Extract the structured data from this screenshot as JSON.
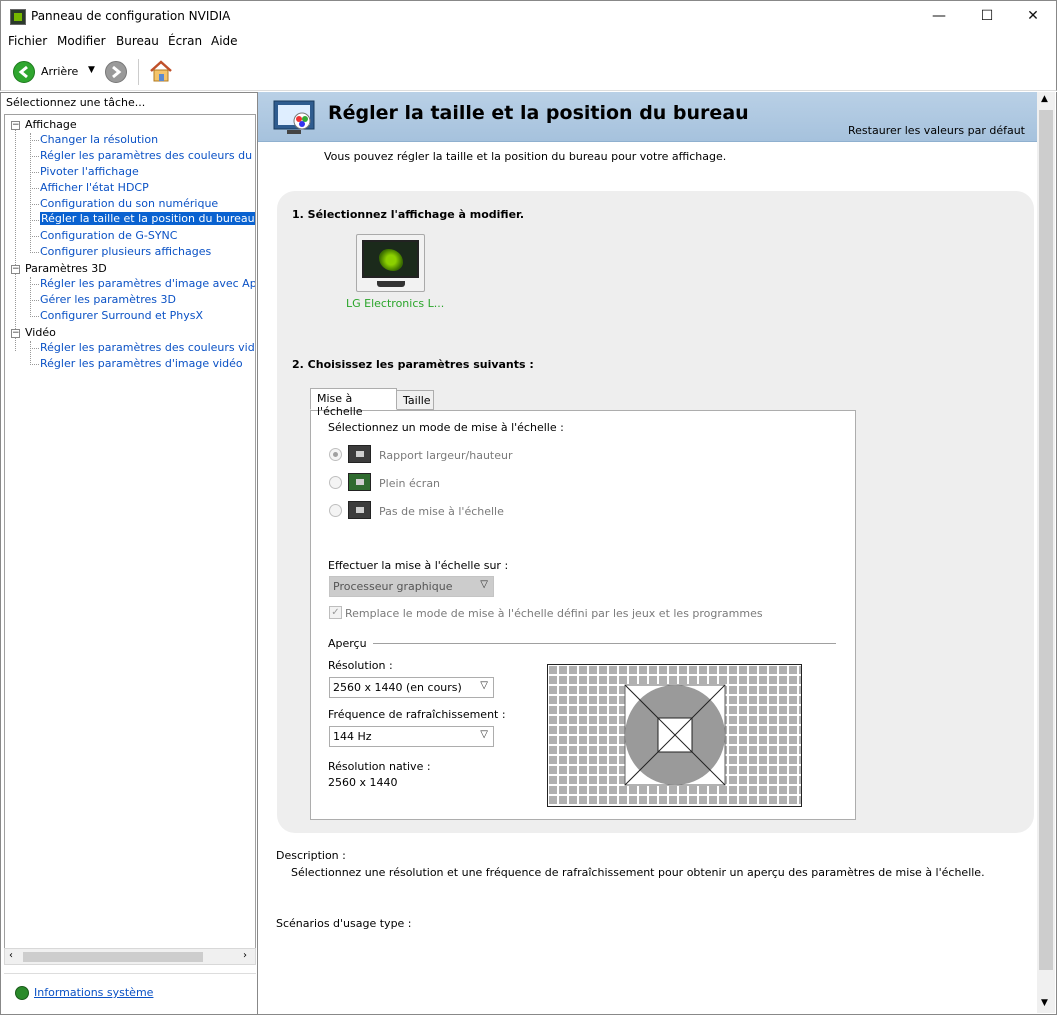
{
  "window": {
    "title": "Panneau de configuration NVIDIA",
    "minimize": "—",
    "maximize": "☐",
    "close": "✕"
  },
  "menu": {
    "items": [
      "Fichier",
      "Modifier",
      "Bureau",
      "Écran",
      "Aide"
    ]
  },
  "toolbar": {
    "back_label": "Arrière"
  },
  "sidebar": {
    "header": "Sélectionnez une tâche...",
    "categories": [
      {
        "label": "Affichage",
        "items": [
          "Changer la résolution",
          "Régler les paramètres des couleurs du bureau",
          "Pivoter l'affichage",
          "Afficher l'état HDCP",
          "Configuration du son numérique",
          "Régler la taille et la position du bureau",
          "Configuration de G-SYNC",
          "Configurer plusieurs affichages"
        ]
      },
      {
        "label": "Paramètres 3D",
        "items": [
          "Régler les paramètres d'image avec Aperçu",
          "Gérer les paramètres 3D",
          "Configurer Surround et PhysX"
        ]
      },
      {
        "label": "Vidéo",
        "items": [
          "Régler les paramètres des couleurs vidéo",
          "Régler les paramètres d'image vidéo"
        ]
      }
    ],
    "selected": "Régler la taille et la position du bureau",
    "sysinfo": "Informations système"
  },
  "main": {
    "title": "Régler la taille et la position du bureau",
    "restore": "Restaurer les valeurs par défaut",
    "intro": "Vous pouvez régler la taille et la position du bureau pour votre affichage.",
    "step1": "1. Sélectionnez l'affichage à modifier.",
    "display_name": "LG Electronics L...",
    "step2": "2. Choisissez les paramètres suivants :",
    "tabs": [
      "Mise à l'échelle",
      "Taille"
    ],
    "scaling_mode_label": "Sélectionnez un mode de mise à l'échelle :",
    "modes": [
      "Rapport largeur/hauteur",
      "Plein écran",
      "Pas de mise à l'échelle"
    ],
    "perform_on_label": "Effectuer la mise à l'échelle sur :",
    "perform_on_value": "Processeur graphique",
    "override_label": "Remplace le mode de mise à l'échelle défini par les jeux et les programmes",
    "preview_label": "Aperçu",
    "resolution_label": "Résolution :",
    "resolution_value": "2560 x 1440 (en cours)",
    "refresh_label": "Fréquence de rafraîchissement :",
    "refresh_value": "144 Hz",
    "native_label": "Résolution native :",
    "native_value": "2560 x 1440",
    "description_label": "Description :",
    "description_text": "Sélectionnez une résolution et une fréquence de rafraîchissement pour obtenir un aperçu des paramètres de mise à l'échelle.",
    "scenarios_label": "Scénarios d'usage type :"
  },
  "colors": {
    "link": "#0b52c5",
    "selection": "#0a62d0",
    "display_name": "#2aa52a",
    "banner": "#a6c2dd"
  }
}
